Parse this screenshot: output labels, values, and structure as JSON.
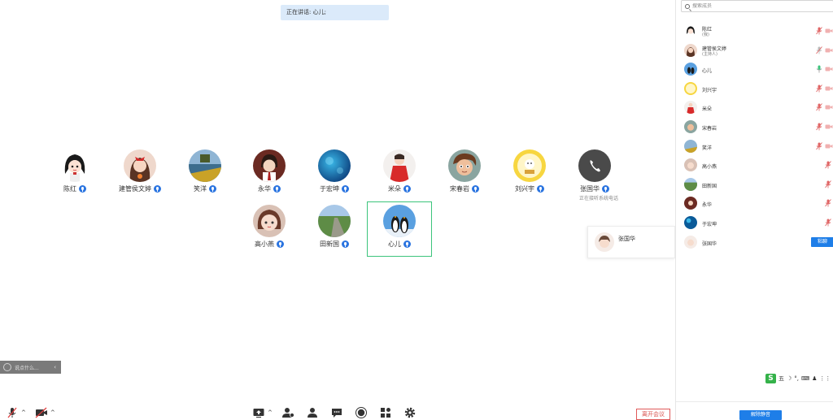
{
  "speaking_banner": "正在讲话: 心儿;",
  "gallery": [
    {
      "name": "陈红",
      "avatar": "avatar-cartoon-girl-black-hair"
    },
    {
      "name": "建管侯文婷",
      "avatar": "avatar-girl-red-bow"
    },
    {
      "name": "笑洋",
      "avatar": "avatar-lakeside-photo"
    },
    {
      "name": "永华",
      "avatar": "avatar-anime-boy"
    },
    {
      "name": "于宏坤",
      "avatar": "avatar-blue-bubbles"
    },
    {
      "name": "米朵",
      "avatar": "avatar-girl-red-dress"
    },
    {
      "name": "宋春岩",
      "avatar": "avatar-cartoon-boy"
    },
    {
      "name": "刘兴宇",
      "avatar": "avatar-sticker-badge"
    },
    {
      "name": "张国华",
      "avatar": "phone-icon",
      "sub": "正在接听系统电话"
    },
    {
      "name": "高小燕",
      "avatar": "avatar-cartoon-girl-pink"
    },
    {
      "name": "田新国",
      "avatar": "avatar-road-landscape"
    },
    {
      "name": "心儿",
      "avatar": "avatar-penguins",
      "active": true
    }
  ],
  "side_card": {
    "name": "张国华"
  },
  "input_hint": {
    "text": "说点什么...",
    "chevron": "‹"
  },
  "toolbar": {
    "leave_label": "离开会议",
    "caret": "^"
  },
  "panel": {
    "search_placeholder": "搜索成员",
    "members": [
      {
        "name": "陈红",
        "role": "(我)",
        "mic": "muted",
        "cam": "off"
      },
      {
        "name": "建管侯文婷",
        "role": "(主持人)",
        "mic": "muted-grey",
        "cam": "off"
      },
      {
        "name": "心儿",
        "mic": "on-green",
        "cam": "off"
      },
      {
        "name": "刘兴宇",
        "mic": "muted",
        "cam": "off"
      },
      {
        "name": "米朵",
        "mic": "muted",
        "cam": "off"
      },
      {
        "name": "宋春岩",
        "mic": "muted",
        "cam": "off"
      },
      {
        "name": "笑洋",
        "mic": "muted",
        "cam": "off"
      },
      {
        "name": "高小燕",
        "mic": "muted"
      },
      {
        "name": "田新国",
        "mic": "muted"
      },
      {
        "name": "永华",
        "mic": "muted"
      },
      {
        "name": "于宏坤",
        "mic": "muted"
      },
      {
        "name": "张国华",
        "invite": "粘聊"
      }
    ],
    "unmute_all_label": "解除静音"
  },
  "ime_toolbar": {
    "logo": "S",
    "mode": "五",
    "items": [
      "☽",
      "°,",
      "⌨",
      "♟",
      "⋮⋮"
    ]
  },
  "colors": {
    "accent": "#1e7ee8",
    "active_border": "#3cc47c",
    "banner_bg": "#dbeafa",
    "leave_red": "#d9534f",
    "muted_red": "#e06666"
  }
}
